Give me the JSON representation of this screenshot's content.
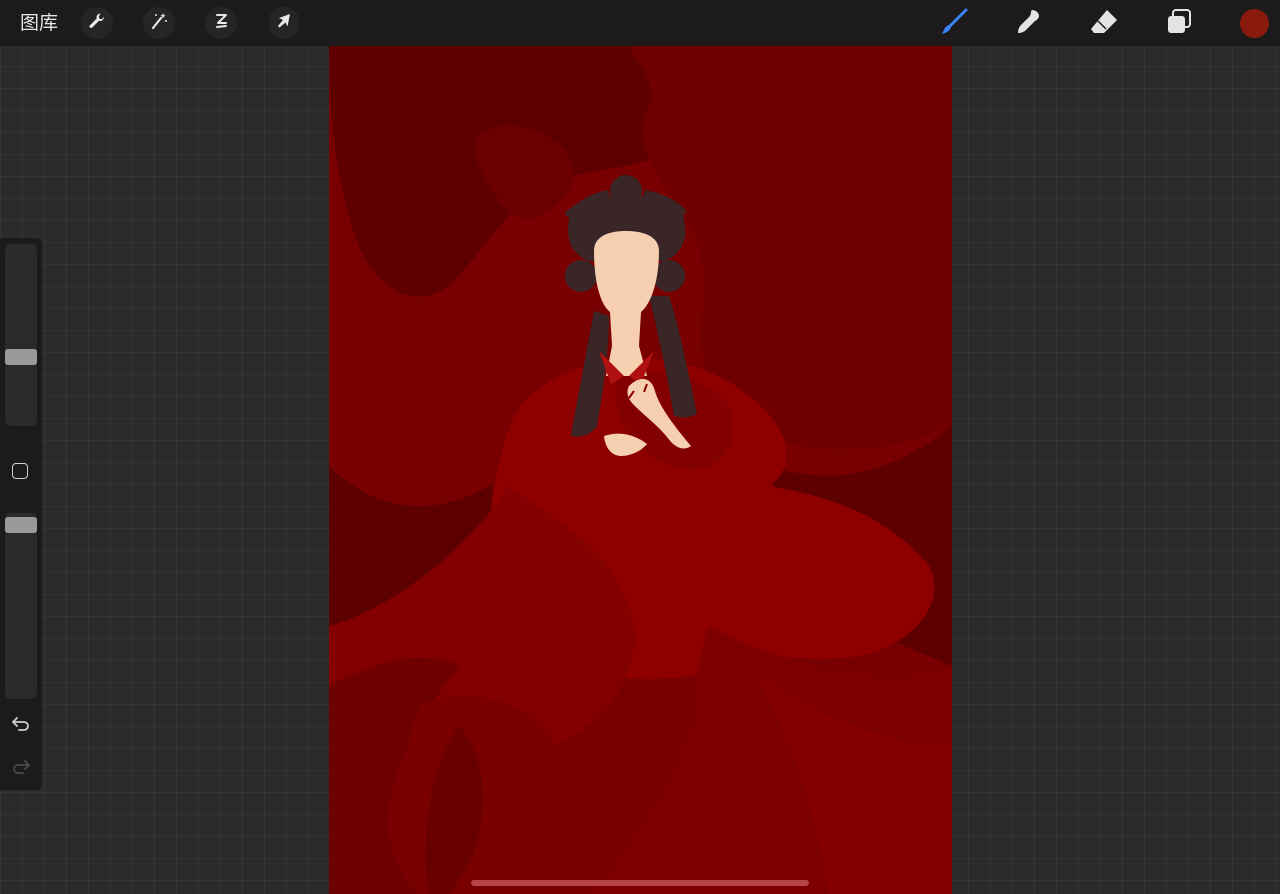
{
  "toolbar": {
    "gallery_label": "图库",
    "left_tools": [
      {
        "name": "actions",
        "icon": "wrench-icon"
      },
      {
        "name": "adjustments",
        "icon": "magic-wand-icon"
      },
      {
        "name": "selection",
        "icon": "selection-icon"
      },
      {
        "name": "transform",
        "icon": "arrow-cursor-icon"
      }
    ],
    "right_tools": [
      {
        "name": "brush",
        "icon": "brush-icon",
        "active": true
      },
      {
        "name": "smudge",
        "icon": "smudge-icon",
        "active": false
      },
      {
        "name": "eraser",
        "icon": "eraser-icon",
        "active": false
      },
      {
        "name": "layers",
        "icon": "layers-icon",
        "active": false
      }
    ],
    "current_color": "#8a1a0e",
    "active_tool_color": "#3b82f6"
  },
  "sidebar": {
    "brush_size_slider_icon": "slider-icon",
    "modify_button_icon": "square-icon",
    "opacity_slider_icon": "slider-icon",
    "undo_icon": "undo-icon",
    "redo_icon": "redo-icon"
  },
  "canvas": {
    "description_icon": "illustration-canvas",
    "palette": {
      "background": "#7a0000",
      "shadow": "#5c0000",
      "robe": "#8e0000",
      "robe_dark": "#7d0000",
      "hair": "#3a2626",
      "skin": "#f5cfb0"
    }
  }
}
